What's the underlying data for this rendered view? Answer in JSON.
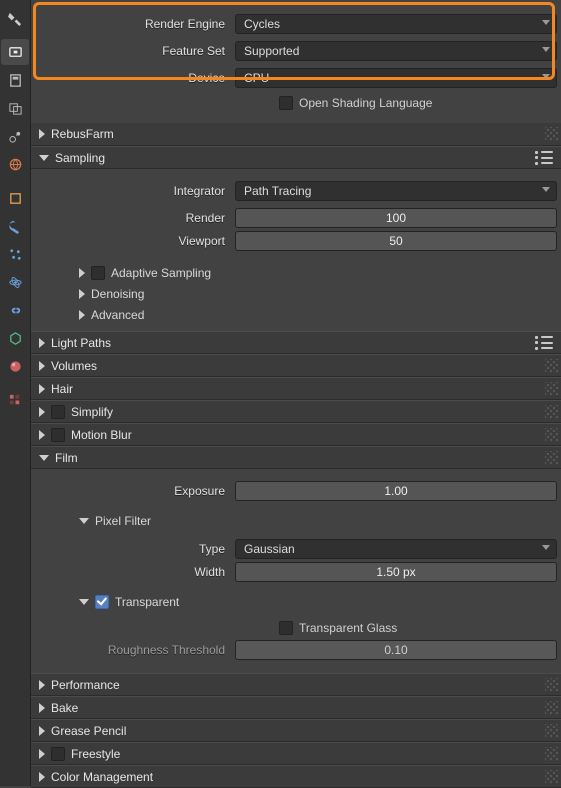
{
  "top": {
    "render_engine": {
      "label": "Render Engine",
      "value": "Cycles"
    },
    "feature_set": {
      "label": "Feature Set",
      "value": "Supported"
    },
    "device": {
      "label": "Device",
      "value": "CPU"
    },
    "osl": "Open Shading Language"
  },
  "panels": {
    "rebusfarm": "RebusFarm",
    "sampling": "Sampling",
    "light_paths": "Light Paths",
    "volumes": "Volumes",
    "hair": "Hair",
    "simplify": "Simplify",
    "motion_blur": "Motion Blur",
    "film": "Film",
    "performance": "Performance",
    "bake": "Bake",
    "grease_pencil": "Grease Pencil",
    "freestyle": "Freestyle",
    "color_management": "Color Management"
  },
  "sampling": {
    "integrator": {
      "label": "Integrator",
      "value": "Path Tracing"
    },
    "render": {
      "label": "Render",
      "value": "100"
    },
    "viewport": {
      "label": "Viewport",
      "value": "50"
    },
    "sub": {
      "adaptive": "Adaptive Sampling",
      "denoising": "Denoising",
      "advanced": "Advanced"
    }
  },
  "film": {
    "exposure": {
      "label": "Exposure",
      "value": "1.00"
    },
    "pixel_filter": "Pixel Filter",
    "type": {
      "label": "Type",
      "value": "Gaussian"
    },
    "width": {
      "label": "Width",
      "value": "1.50 px"
    },
    "transparent": "Transparent",
    "transparent_glass": "Transparent Glass",
    "roughness": {
      "label": "Roughness Threshold",
      "value": "0.10"
    }
  },
  "icons": {
    "tool": "tool-icon",
    "render": "render-icon",
    "output": "output-icon",
    "view": "view-icon",
    "scene": "scene-icon",
    "world": "world-icon",
    "object": "object-icon",
    "modifier": "modifier-icon",
    "particle": "particle-icon",
    "physics": "physics-icon",
    "constraint": "constraint-icon",
    "mesh": "mesh-icon",
    "material": "material-icon",
    "texture": "texture-icon"
  }
}
